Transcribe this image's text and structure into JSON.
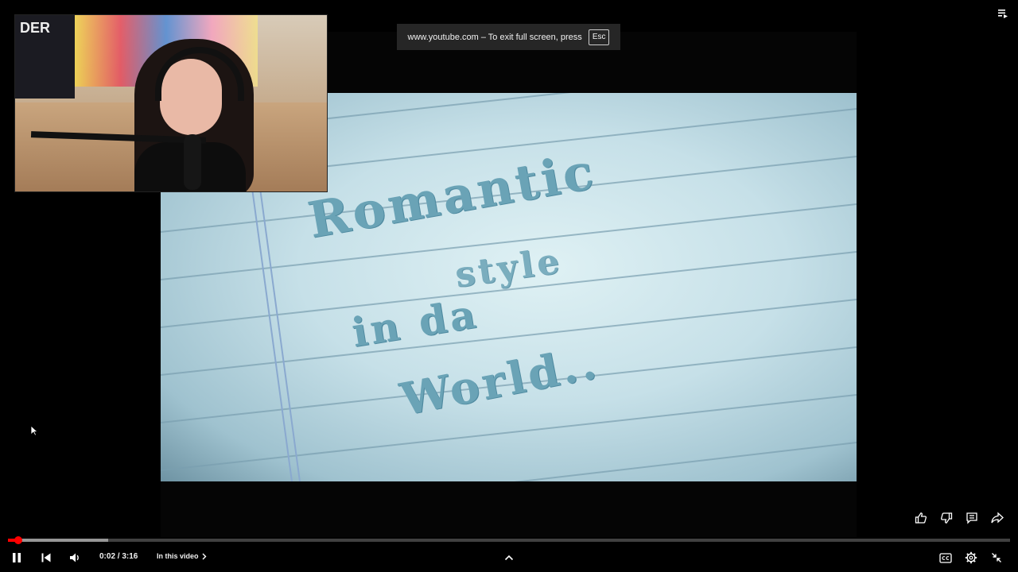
{
  "fullscreen_notice": {
    "text": "www.youtube.com – To exit full screen, press",
    "key": "Esc"
  },
  "webcam": {
    "poster_text": "DER"
  },
  "video": {
    "title_lines": [
      "Romantic",
      "style",
      "in da",
      "World.."
    ]
  },
  "player": {
    "time_display": "0:02 / 3:16",
    "chapter_label": "In this video",
    "progress_played_fraction": 0.0106,
    "progress_buffered_fraction": 0.1,
    "icons": {
      "playlist": "playlist-icon",
      "like": "thumbs-up-icon",
      "dislike": "thumbs-down-icon",
      "comments": "comment-icon",
      "share": "share-icon",
      "pause": "pause-icon",
      "previous": "previous-icon",
      "volume": "volume-icon",
      "chevron": "chevron-right-icon",
      "expand": "chevron-up-icon",
      "captions": "captions-icon",
      "settings": "gear-icon",
      "exit_fullscreen": "exit-fullscreen-icon"
    },
    "colors": {
      "progress": "#ff0000",
      "background": "#000000"
    }
  }
}
